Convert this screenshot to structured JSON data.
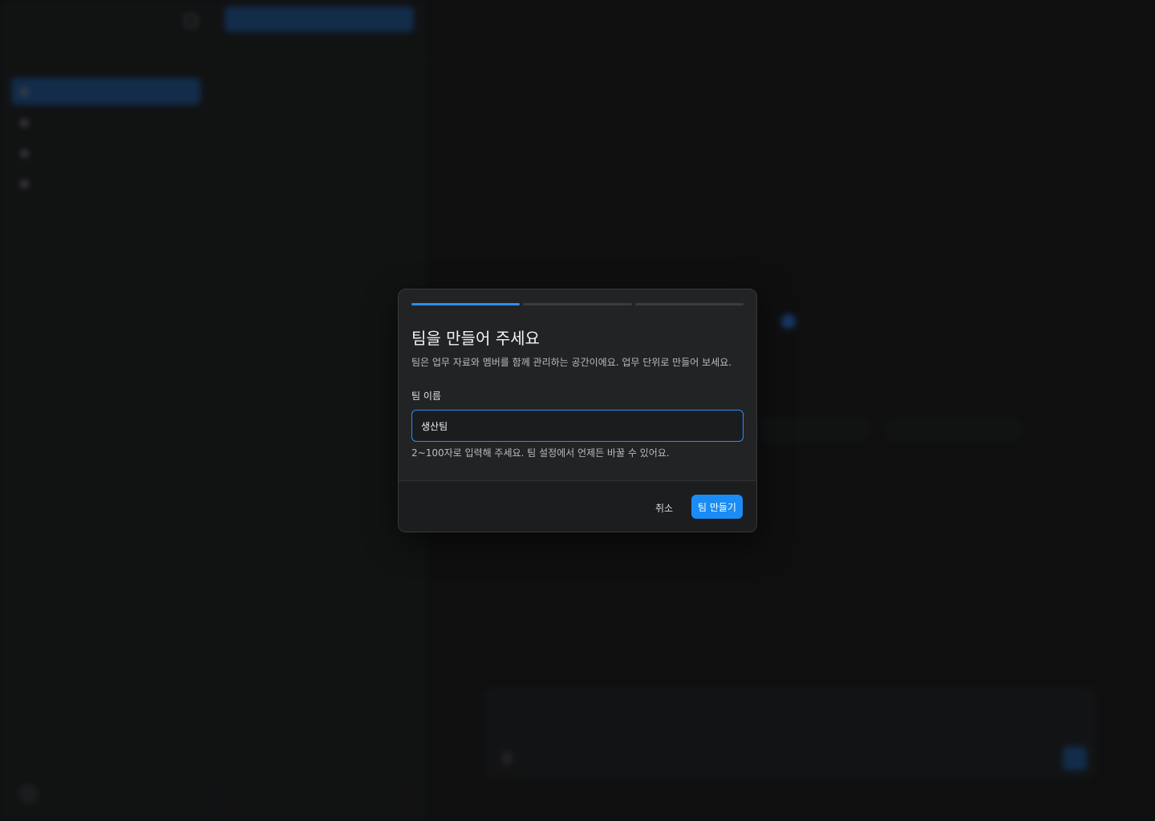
{
  "colors": {
    "accent": "#1a8cf5",
    "modal_bg": "#222325",
    "page_bg": "#151617"
  },
  "modal": {
    "title": "팀을 만들어 주세요",
    "description": "팀은 업무 자료와 멤버를 함께 관리하는 공간이에요. 업무 단위로 만들어 보세요.",
    "steps_total": 3,
    "step_current": 1,
    "field_label": "팀 이름",
    "field_value": "생산팀",
    "field_help": "2~100자로 입력해 주세요. 팀 설정에서 언제든 바꿀 수 있어요.",
    "cancel_label": "취소",
    "create_label": "팀 만들기"
  }
}
